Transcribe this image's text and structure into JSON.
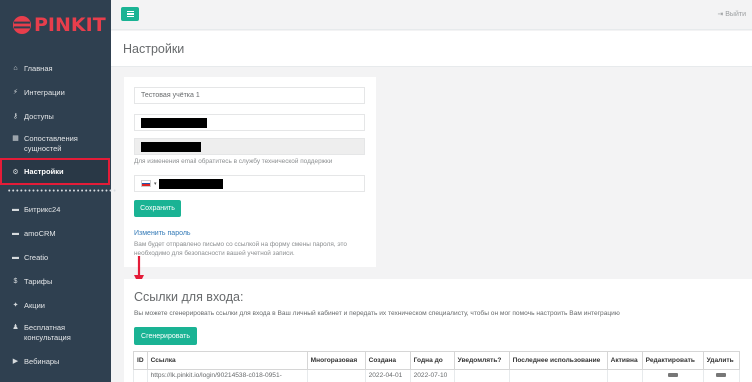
{
  "brand": {
    "name": "PINKIT",
    "color": "#e83e4c"
  },
  "sidebar": {
    "items": [
      {
        "icon": "home-icon",
        "glyph": "⌂",
        "label": "Главная"
      },
      {
        "icon": "plug-icon",
        "glyph": "⚡",
        "label": "Интеграции"
      },
      {
        "icon": "key-icon",
        "glyph": "⚷",
        "label": "Доступы"
      },
      {
        "icon": "table-icon",
        "glyph": "▦",
        "label": "Сопоставления сущностей"
      },
      {
        "icon": "gears-icon",
        "glyph": "⚙",
        "label": "Настройки",
        "active": true
      },
      {
        "icon": "bitrix-icon",
        "glyph": "▬",
        "label": "Битрикс24"
      },
      {
        "icon": "amocrm-icon",
        "glyph": "▬",
        "label": "amoCRM"
      },
      {
        "icon": "creatio-icon",
        "glyph": "▬",
        "label": "Creatio"
      },
      {
        "icon": "dollar-icon",
        "glyph": "$",
        "label": "Тарифы"
      },
      {
        "icon": "gift-icon",
        "glyph": "✦",
        "label": "Акции"
      },
      {
        "icon": "user-icon",
        "glyph": "♟",
        "label": "Бесплатная консультация"
      },
      {
        "icon": "video-icon",
        "glyph": "▶",
        "label": "Вебинары"
      }
    ],
    "separator": "•••••••••••••••••••••••••••"
  },
  "topbar": {
    "logout_label": "Выйти",
    "menu_icon": "hamburger-icon",
    "accent": "#1ab394"
  },
  "page": {
    "title": "Настройки"
  },
  "settings": {
    "account_name": "Тестовая учётка 1",
    "email_hint": "Для изменения email обратитесь в службу технической поддержки",
    "save_label": "Сохранить",
    "change_password_label": "Изменить пароль",
    "password_hint": "Вам будет отправлено письмо со ссылкой на форму смены пароля, это необходимо для безопасности вашей учетной записи."
  },
  "links": {
    "title": "Ссылки для входа:",
    "description": "Вы можете сгенерировать ссылки для входа в Ваш личный кабинет и передать их техническом специалисту, чтобы он мог помочь настроить Вам интеграцию",
    "generate_label": "Сгенерировать",
    "columns": [
      "ID",
      "Ссылка",
      "Многоразовая",
      "Создана",
      "Годна до",
      "Уведомлять?",
      "Последнее использование",
      "Активна",
      "Редактировать",
      "Удалить"
    ],
    "rows": [
      [
        "",
        "https://lk.pinkit.io/login/90214538-c018-0951-",
        "",
        "2022-04-01",
        "2022-07-10",
        "",
        "",
        "",
        "",
        ""
      ]
    ]
  }
}
